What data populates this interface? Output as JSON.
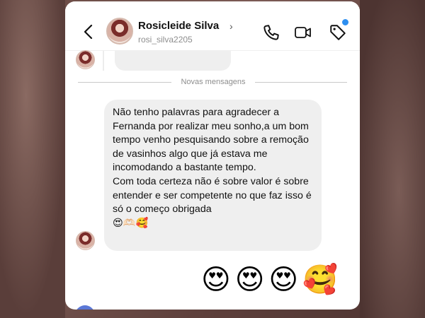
{
  "header": {
    "name": "Rosicleide Silva",
    "chevron": "›",
    "handle": "rosi_silva2205",
    "icons": [
      "back-arrow-icon",
      "phone-icon",
      "video-camera-icon",
      "tag-icon"
    ]
  },
  "divider": {
    "label": "Novas mensagens"
  },
  "message": {
    "paragraph1": "Não tenho palavras para agradecer a Fernanda por realizar meu sonho,a um bom tempo venho pesquisando sobre a remoção de vasinhos algo que já estava me incomodando a bastante tempo.",
    "paragraph2": "Com toda certeza não é sobre valor é sobre entender e ser competente no que faz isso é só o começo obrigada",
    "emojis": "😍🫶🏻🥰"
  },
  "reactions": [
    "😍",
    "😍",
    "😍",
    "🥰"
  ],
  "colors": {
    "accent_dot": "#2d8ff0",
    "bubble": "#efefef"
  }
}
